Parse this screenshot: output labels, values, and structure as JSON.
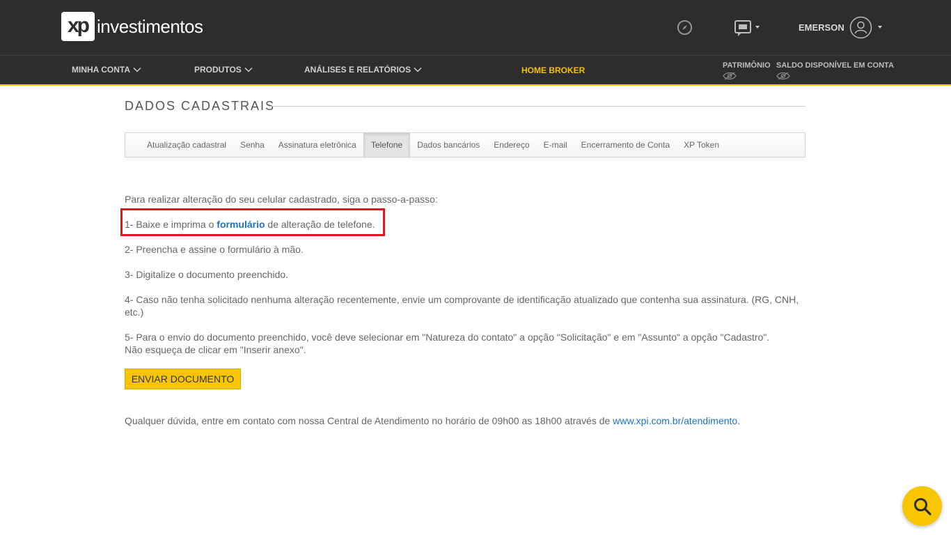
{
  "header": {
    "logo_mark": "xp",
    "logo_text": "investimentos",
    "username": "EMERSON"
  },
  "nav": {
    "items": [
      {
        "label": "MINHA CONTA"
      },
      {
        "label": "PRODUTOS"
      },
      {
        "label": "ANÁLISES E RELATÓRIOS"
      },
      {
        "label": "HOME BROKER"
      }
    ],
    "patrimonio_label": "PATRIMÔNIO",
    "saldo_label": "SALDO DISPONÍVEL EM CONTA"
  },
  "page": {
    "title": "DADOS CADASTRAIS",
    "tabs": [
      {
        "label": "Atualização cadastral"
      },
      {
        "label": "Senha"
      },
      {
        "label": "Assinatura eletrônica"
      },
      {
        "label": "Telefone"
      },
      {
        "label": "Dados bancários"
      },
      {
        "label": "Endereço"
      },
      {
        "label": "E-mail"
      },
      {
        "label": "Encerramento de Conta"
      },
      {
        "label": "XP Token"
      }
    ],
    "active_tab": "Telefone",
    "intro": "Para realizar alteração do seu celular cadastrado, siga o passo-a-passo:",
    "step1_prefix": "1- Baixe e imprima o ",
    "step1_link": "formulário",
    "step1_suffix": " de alteração de telefone.",
    "step2": "2- Preencha e assine o formulário à mão.",
    "step3": "3- Digitalize o documento preenchido.",
    "step4": "4- Caso não tenha solicitado nenhuma alteração recentemente, envie um comprovante de identificação atualizado que contenha sua assinatura. (RG, CNH, etc.)",
    "step5_line1": "5- Para o envio do documento preenchido, você deve selecionar em \"Natureza do contato\" a opção \"Solicitação\" e em \"Assunto\" a opção \"Cadastro\".",
    "step5_line2": "Não esqueça de clicar em \"Inserir anexo\".",
    "send_button": "ENVIAR DOCUMENTO",
    "footer_prefix": "Qualquer dúvida, entre em contato com nossa Central de Atendimento no horário de 09h00 as 18h00 através de ",
    "footer_link": "www.xpi.com.br/atendimento",
    "footer_suffix": "."
  },
  "colors": {
    "header_bg": "#2d2d2d",
    "accent": "#f5c100",
    "link": "#1e73be",
    "highlight": "#e0151f"
  }
}
